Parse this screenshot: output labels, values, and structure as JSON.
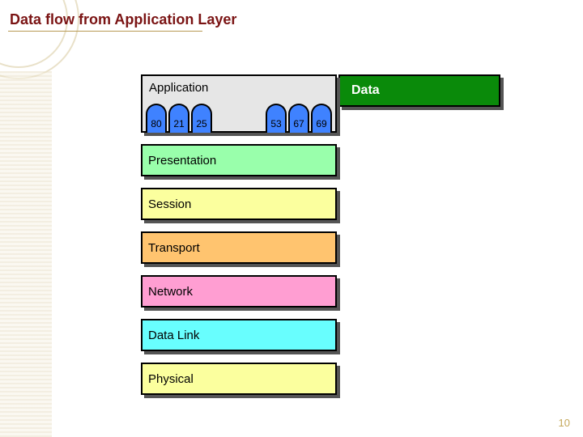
{
  "title": "Data flow from Application Layer",
  "page_number": "10",
  "data_label": "Data",
  "ports_left": [
    "80",
    "21",
    "25"
  ],
  "ports_right": [
    "53",
    "67",
    "69"
  ],
  "layers": {
    "application": "Application",
    "presentation": "Presentation",
    "session": "Session",
    "transport": "Transport",
    "network": "Network",
    "datalink": "Data Link",
    "physical": "Physical"
  },
  "colors": {
    "title": "#7a1313",
    "data_bg": "#0a8a0a",
    "port_bg": "#3f82ff"
  }
}
